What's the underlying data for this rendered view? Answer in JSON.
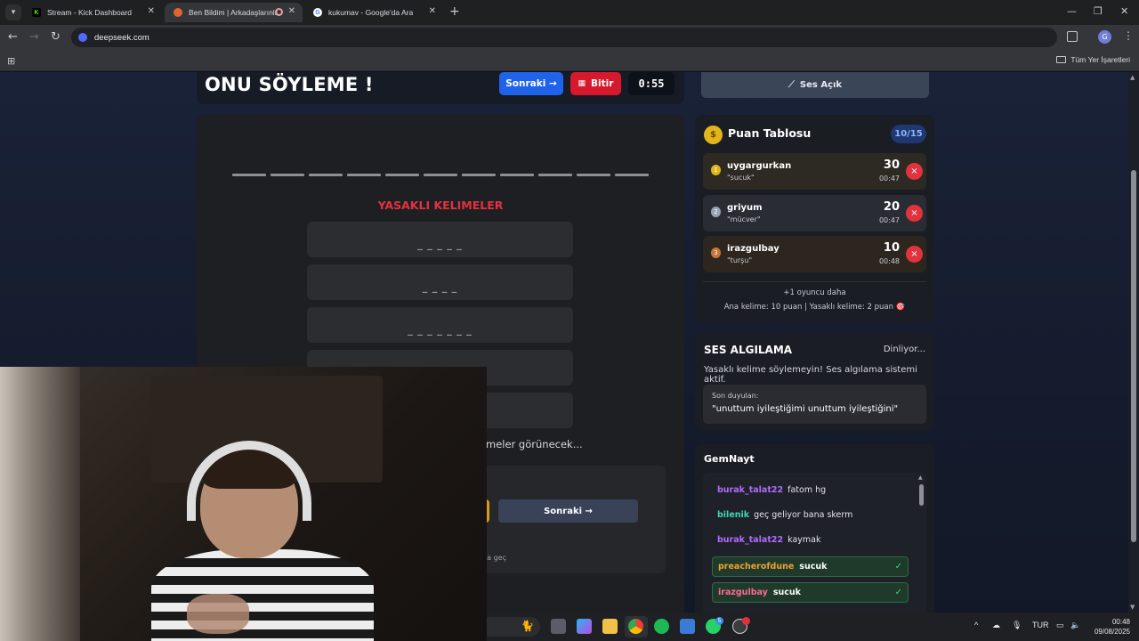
{
  "browser": {
    "tabs": [
      {
        "title": "Stream - Kick Dashboard",
        "favicon": "K",
        "favicon_color": "#53fc18"
      },
      {
        "title": "Ben Bildim | Arkadaşlarınla",
        "favicon": "",
        "favicon_color": "#e0642c"
      },
      {
        "title": "kukumav - Google'da Ara",
        "favicon": "G",
        "favicon_color": "#ffffff"
      }
    ],
    "url": "deepseek.com",
    "bookmarks_all": "Tüm Yer İşaretleri",
    "profile_initial": "G"
  },
  "game": {
    "title": "ONU SÖYLEME !",
    "next_button": "Sonraki →",
    "finish_button": "Bitir",
    "timer": "0:55",
    "blank_count": 11,
    "forbidden_title": "YASAKLI KELIMELER",
    "forbidden_words": [
      "_ _ _ _ _",
      "_ _ _ _",
      "_ _ _ _ _ _ _",
      "",
      ""
    ],
    "hint_text": "meler görünecek...",
    "bottom_next_button": "Sonraki →",
    "skip_hint": "soruya geç"
  },
  "sound": {
    "label": "Ses Açık",
    "icon": "microphone-icon"
  },
  "scoreboard": {
    "title": "Puan Tablosu",
    "round": "10/15",
    "players": [
      {
        "name": "uygargurkan",
        "word": "\"sucuk\"",
        "score": "30",
        "time": "00:47",
        "medal": "gold",
        "medal_color": "#e2b61b"
      },
      {
        "name": "griyum",
        "word": "\"mücver\"",
        "score": "20",
        "time": "00:47",
        "medal": "silver",
        "medal_color": "#9aa3b5"
      },
      {
        "name": "irazgulbay",
        "word": "\"turşu\"",
        "score": "10",
        "time": "00:48",
        "medal": "bronze",
        "medal_color": "#c7743a"
      }
    ],
    "remove_label": "×",
    "more_players": "+1 oyuncu daha",
    "points_info": "Ana kelime: 10 puan | Yasaklı kelime: 2 puan 🎯"
  },
  "voice": {
    "title": "SES ALGILAMA",
    "status": "Dinliyor...",
    "description": "Yasaklı kelime söylemeyin! Ses algılama sistemi aktif.",
    "heard_label": "Son duyulan:",
    "heard_text": "\"unuttum iyileştiğimi unuttum iyileştiğini\""
  },
  "chat": {
    "title": "GemNayt",
    "messages": [
      {
        "user": "burak_talat22",
        "text": "fatom hg",
        "color": "#b06cff",
        "hit": false
      },
      {
        "user": "bilenik",
        "text": "geç geliyor bana skerm",
        "color": "#3fd6b0",
        "hit": false
      },
      {
        "user": "burak_talat22",
        "text": "kaymak",
        "color": "#b06cff",
        "hit": false
      },
      {
        "user": "preacherofdune",
        "text": "sucuk",
        "color": "#f0a030",
        "hit": true
      },
      {
        "user": "irazgulbay",
        "text": "sucuk",
        "color": "#ff6b8f",
        "hit": true
      }
    ],
    "check": "✓"
  },
  "taskbar": {
    "language": "TUR",
    "time": "00:48",
    "date": "09/08/2025",
    "whatsapp_badge": "5"
  }
}
